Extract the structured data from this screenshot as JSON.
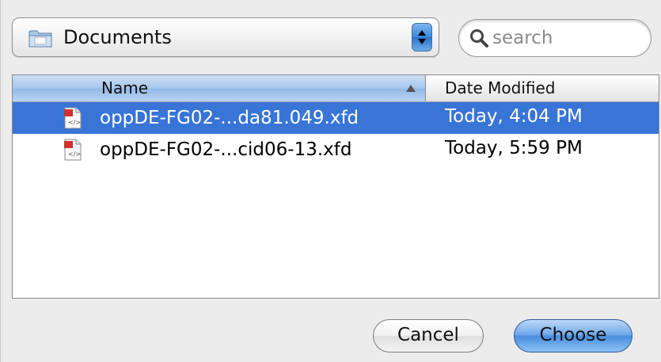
{
  "location": {
    "folder": "Documents",
    "folder_icon": "folder-icon"
  },
  "search": {
    "placeholder": "search",
    "value": ""
  },
  "file_list": {
    "columns": [
      "Name",
      "Date Modified"
    ],
    "sort_column": "Name",
    "sort_direction": "ascending",
    "rows": [
      {
        "name": "oppDE-FG02-...da81.049.xfd",
        "date": "Today, 4:04 PM",
        "selected": true,
        "icon": "xfd-document-icon"
      },
      {
        "name": "oppDE-FG02-...cid06-13.xfd",
        "date": "Today, 5:59 PM",
        "selected": false,
        "icon": "xfd-document-icon"
      }
    ]
  },
  "buttons": {
    "cancel": "Cancel",
    "choose": "Choose"
  },
  "colors": {
    "selection": "#3875d7",
    "header_active": "#a7c7ec",
    "default_button": "#4a8fe0"
  }
}
